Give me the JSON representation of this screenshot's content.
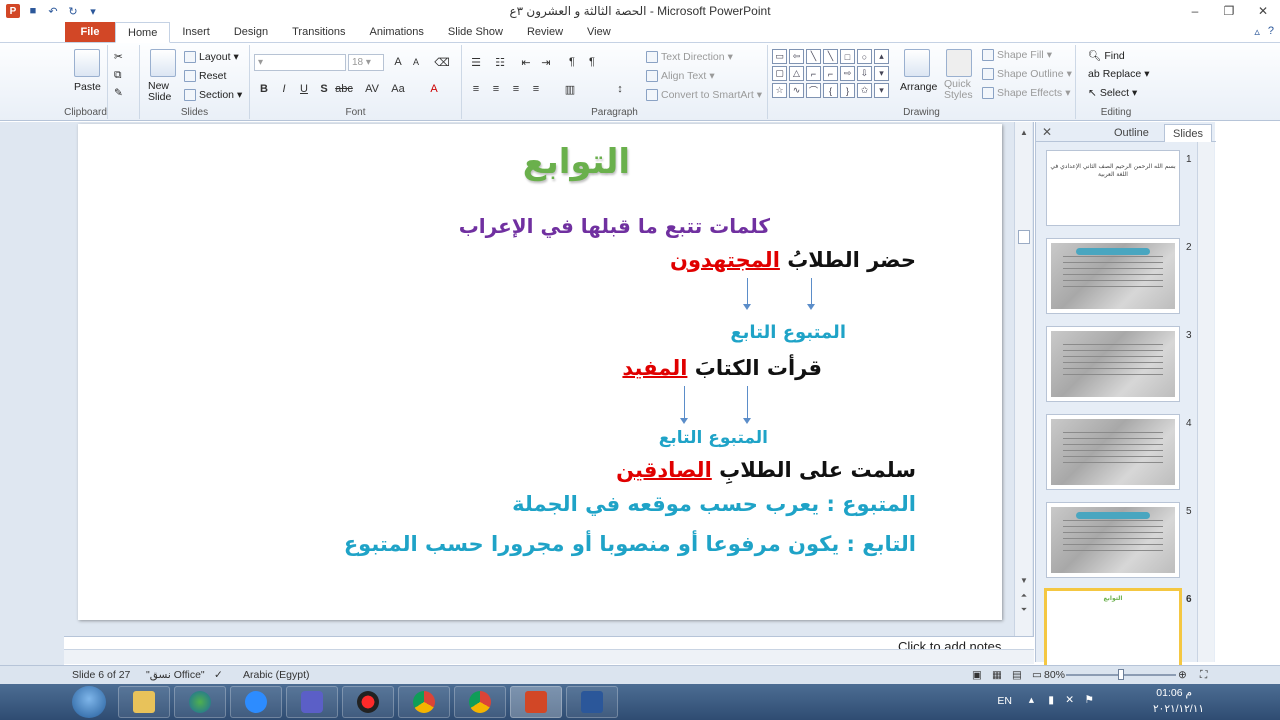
{
  "window": {
    "title": "الحصة الثالثة و العشرون ٣ع - Microsoft PowerPoint",
    "controls": [
      "–",
      "❐",
      "✕"
    ]
  },
  "tabs": {
    "file": "File",
    "items": [
      "Home",
      "Insert",
      "Design",
      "Transitions",
      "Animations",
      "Slide Show",
      "Review",
      "View"
    ],
    "active": "Home"
  },
  "ribbon": {
    "clipboard": {
      "label": "Clipboard",
      "paste": "Paste"
    },
    "slides": {
      "label": "Slides",
      "new_slide": "New Slide",
      "layout": "Layout",
      "reset": "Reset",
      "section": "Section"
    },
    "font": {
      "label": "Font",
      "size": "18"
    },
    "paragraph": {
      "label": "Paragraph",
      "text_direction": "Text Direction",
      "align_text": "Align Text",
      "convert_smartart": "Convert to SmartArt"
    },
    "drawing": {
      "label": "Drawing",
      "arrange": "Arrange",
      "quick_styles": "Quick Styles",
      "shape_fill": "Shape Fill",
      "shape_outline": "Shape Outline",
      "shape_effects": "Shape Effects"
    },
    "editing": {
      "label": "Editing",
      "find": "Find",
      "replace": "Replace",
      "select": "Select"
    }
  },
  "slide": {
    "title": "التوابع",
    "subtitle": "كلمات تتبع ما قبلها في الإعراب",
    "ex1_pre": "حضر الطلابُ ",
    "ex1_red": "المجتهدون",
    "ex1_labels": "المتبوع  التابع",
    "ex2_pre": "قرأت الكتابَ ",
    "ex2_red": "المفيد",
    "ex2_labels": "المتبوع  التابع",
    "ex3_pre": "سلمت على   الطلابِ ",
    "ex3_red": "الصادقين",
    "def1": "المتبوع : يعرب حسب موقعه في الجملة",
    "def2": "التابع : يكون مرفوعا أو منصوبا أو مجرورا حسب المتبوع"
  },
  "panel": {
    "tab_outline": "Outline",
    "tab_slides": "Slides",
    "thumb1_text": "بسم الله الرحمن الرحيم الصف الثاني الإعدادي في اللغة العربية",
    "thumb6_text": "التوابع",
    "thumbs": [
      "1",
      "2",
      "3",
      "4",
      "5",
      "6"
    ],
    "selected": 6
  },
  "notes": {
    "placeholder": "Click to add notes"
  },
  "status": {
    "slide_of": "Slide 6 of 27",
    "theme": "\"نسق Office\"",
    "language": "Arabic (Egypt)",
    "zoom": "80%"
  },
  "taskbar": {
    "lang": "EN",
    "time": "01:06 م",
    "date": "٢٠٢١/١٢/١١"
  }
}
